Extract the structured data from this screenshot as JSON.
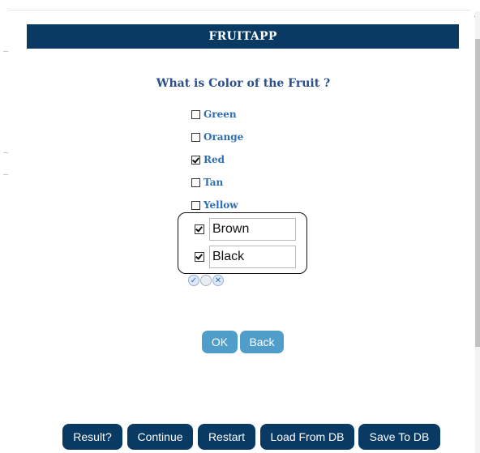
{
  "header": {
    "title": "FRUITAPP"
  },
  "question": {
    "text": "What is Color of the Fruit ?"
  },
  "options": [
    {
      "label": "Green",
      "checked": false
    },
    {
      "label": "Orange",
      "checked": false
    },
    {
      "label": "Red",
      "checked": true
    },
    {
      "label": "Tan",
      "checked": false
    },
    {
      "label": "Yellow",
      "checked": false
    }
  ],
  "custom_options": [
    {
      "value": "Brown",
      "checked": true
    },
    {
      "value": "Black",
      "checked": true
    }
  ],
  "mini_icons": [
    "check-circle-icon",
    "empty-circle-icon",
    "x-circle-icon"
  ],
  "actions": {
    "ok_label": "OK",
    "back_label": "Back"
  },
  "footer": {
    "result_label": "Result?",
    "continue_label": "Continue",
    "restart_label": "Restart",
    "load_label": "Load From DB",
    "save_label": "Save To DB"
  },
  "colors": {
    "header_bg": "#083a63",
    "question_text": "#2a4f8a",
    "option_text": "#2d6db3",
    "light_button": "#4f9ec9",
    "dark_button": "#083a63"
  }
}
